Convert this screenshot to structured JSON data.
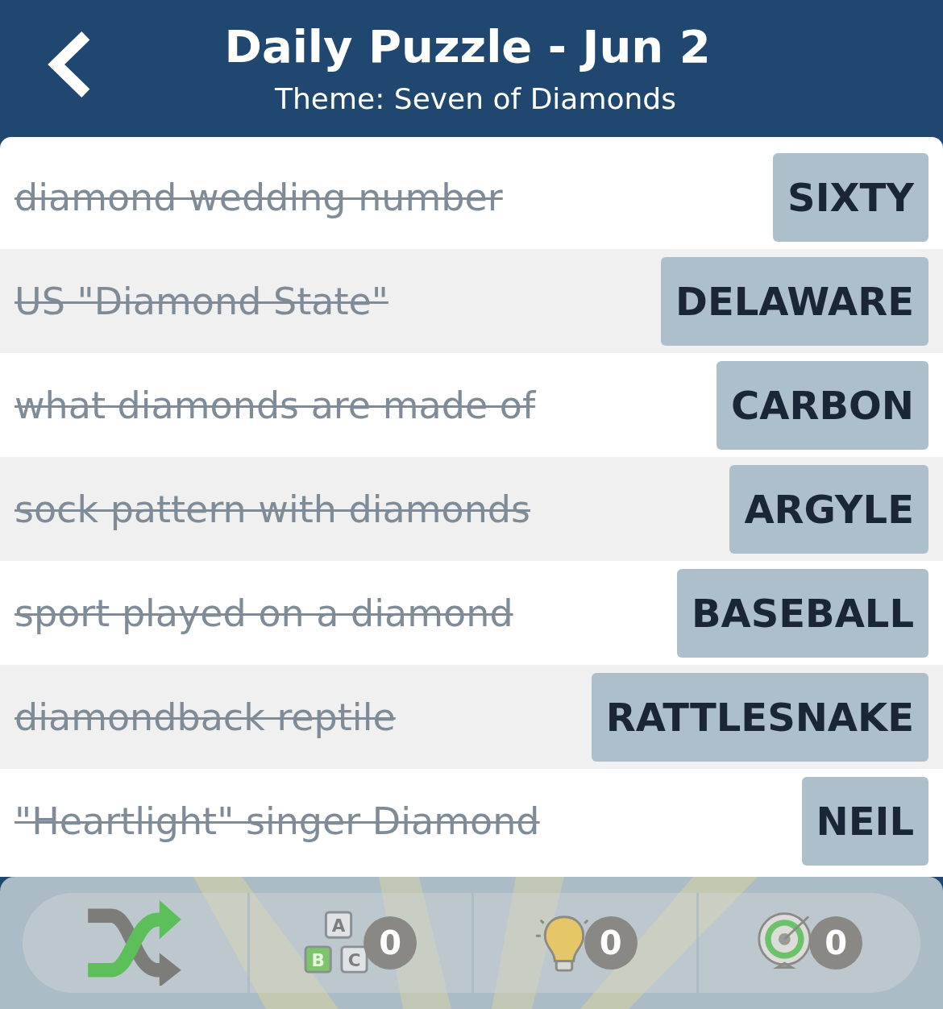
{
  "header": {
    "title": "Daily Puzzle - Jun 2",
    "subtitle": "Theme: Seven of Diamonds"
  },
  "clues": [
    {
      "clue": "diamond wedding number",
      "answer": "SIXTY",
      "solved": true
    },
    {
      "clue": "US \"Diamond State\"",
      "answer": "DELAWARE",
      "solved": true
    },
    {
      "clue": "what diamonds are made of",
      "answer": "CARBON",
      "solved": true
    },
    {
      "clue": "sock pattern with diamonds",
      "answer": "ARGYLE",
      "solved": true
    },
    {
      "clue": "sport played on a diamond",
      "answer": "BASEBALL",
      "solved": true
    },
    {
      "clue": "diamondback reptile",
      "answer": "RATTLESNAKE",
      "solved": true
    },
    {
      "clue": "\"Heartlight\" singer Diamond",
      "answer": "NEIL",
      "solved": true
    }
  ],
  "toolbar": [
    {
      "kind": "shuffle"
    },
    {
      "kind": "letters",
      "letters": [
        "A",
        "B",
        "C"
      ],
      "count": "0"
    },
    {
      "kind": "hint",
      "count": "0"
    },
    {
      "kind": "target",
      "count": "0"
    }
  ]
}
